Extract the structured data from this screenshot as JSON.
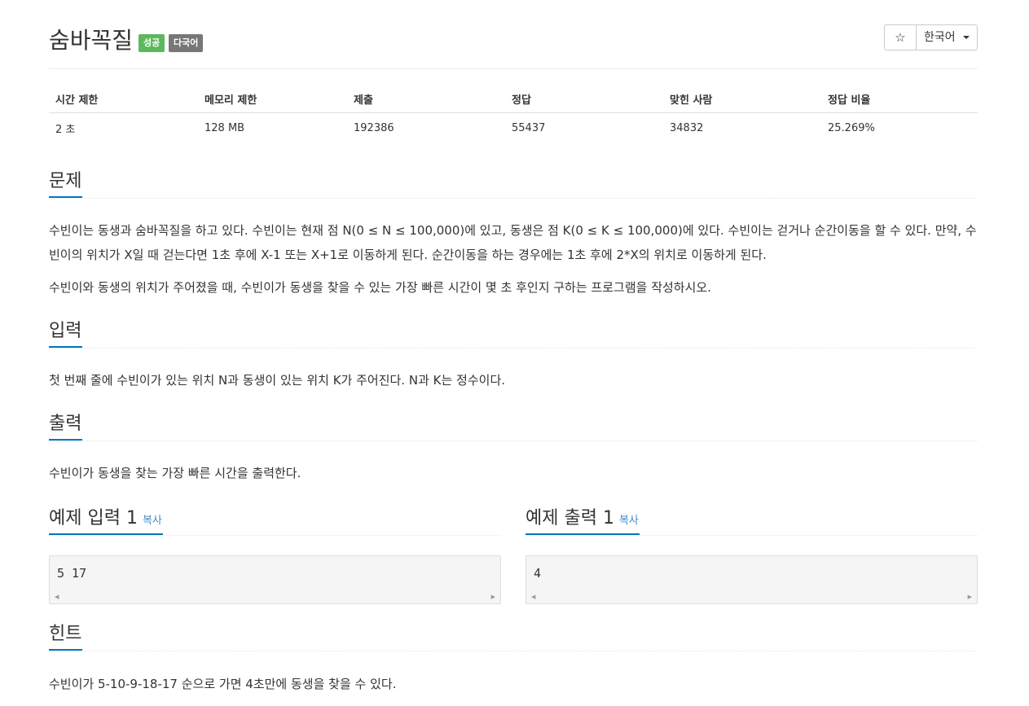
{
  "problem": {
    "title": "숨바꼭질",
    "badges": {
      "success": "성공",
      "multilang": "다국어"
    },
    "star_icon": "☆",
    "language": "한국어"
  },
  "info_table": {
    "headers": [
      "시간 제한",
      "메모리 제한",
      "제출",
      "정답",
      "맞힌 사람",
      "정답 비율"
    ],
    "values": [
      "2 초",
      "128 MB",
      "192386",
      "55437",
      "34832",
      "25.269%"
    ]
  },
  "sections": {
    "description": {
      "title": "문제",
      "paragraphs": [
        "수빈이는 동생과 숨바꼭질을 하고 있다. 수빈이는 현재 점 N(0 ≤ N ≤ 100,000)에 있고, 동생은 점 K(0 ≤ K ≤ 100,000)에 있다. 수빈이는 걷거나 순간이동을 할 수 있다. 만약, 수빈이의 위치가 X일 때 걷는다면 1초 후에 X-1 또는 X+1로 이동하게 된다. 순간이동을 하는 경우에는 1초 후에 2*X의 위치로 이동하게 된다.",
        "수빈이와 동생의 위치가 주어졌을 때, 수빈이가 동생을 찾을 수 있는 가장 빠른 시간이 몇 초 후인지 구하는 프로그램을 작성하시오."
      ]
    },
    "input": {
      "title": "입력",
      "text": "첫 번째 줄에 수빈이가 있는 위치 N과 동생이 있는 위치 K가 주어진다. N과 K는 정수이다."
    },
    "output": {
      "title": "출력",
      "text": "수빈이가 동생을 찾는 가장 빠른 시간을 출력한다."
    },
    "sample_input": {
      "title": "예제 입력 1",
      "copy_label": "복사",
      "code": "5 17"
    },
    "sample_output": {
      "title": "예제 출력 1",
      "copy_label": "복사",
      "code": "4"
    },
    "hint": {
      "title": "힌트",
      "text": "수빈이가 5-10-9-18-17 순으로 가면 4초만에 동생을 찾을 수 있다."
    }
  },
  "colors": {
    "success_badge": "#5cb85c",
    "multilang_badge": "#777777",
    "section_underline": "#0076c0",
    "copy_link": "#428bca"
  },
  "icons": {
    "star": "star-icon",
    "caret": "caret-down-icon",
    "scroll_left": "scroll-left-icon",
    "scroll_right": "scroll-right-icon"
  }
}
